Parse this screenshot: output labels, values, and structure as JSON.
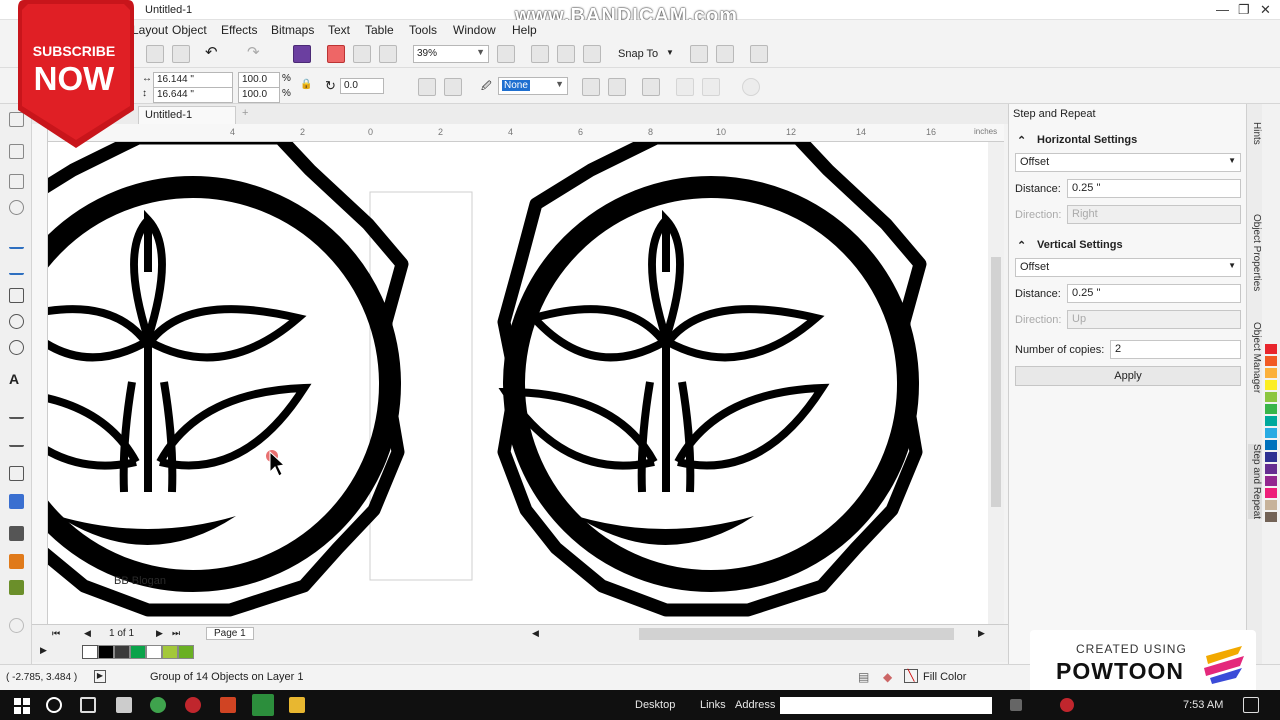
{
  "window": {
    "doc_title": "Untitled-1",
    "watermark": "www.BANDICAM.com",
    "min": "—",
    "max": "❐",
    "close": "✕"
  },
  "menu": [
    "Layout",
    "Object",
    "Effects",
    "Bitmaps",
    "Text",
    "Table",
    "Tools",
    "Window",
    "Help"
  ],
  "toolbar": {
    "zoom": "39%",
    "snap_to": "Snap To"
  },
  "property_bar": {
    "width": "16.144 \"",
    "height": "16.644 \"",
    "scale_x": "100.0",
    "scale_y": "100.0",
    "percent": "%",
    "angle": "0.0",
    "outline": "None"
  },
  "tabs": {
    "active": "Untitled-1",
    "add": "+"
  },
  "ruler": {
    "units": "inches",
    "ticks": [
      "4",
      "2",
      "0",
      "2",
      "4",
      "6",
      "8",
      "10",
      "12",
      "14",
      "16"
    ]
  },
  "canvas": {
    "faint_label": "BB Blogan"
  },
  "page_nav": {
    "counter": "1 of 1",
    "page_tab": "Page 1"
  },
  "palette": {
    "colors": [
      "#000000",
      "#ffffff",
      "#3a3a3a",
      "#000000",
      "#0aa34a",
      "#ffffff",
      "#a3c83a",
      "#6ab023",
      "#9acd32"
    ]
  },
  "status": {
    "coords": "( -2.785, 3.484 )",
    "selection": "Group of 14 Objects on Layer 1",
    "fill_label": "Fill Color"
  },
  "docker": {
    "title": "Step and Repeat",
    "horizontal": {
      "heading": "Horizontal Settings",
      "mode": "Offset",
      "distance_label": "Distance:",
      "distance": "0.25 \"",
      "direction_label": "Direction:",
      "direction": "Right"
    },
    "vertical": {
      "heading": "Vertical Settings",
      "mode": "Offset",
      "distance_label": "Distance:",
      "distance": "0.25 \"",
      "direction_label": "Direction:",
      "direction": "Up"
    },
    "copies_label": "Number of copies:",
    "copies": "2",
    "apply": "Apply"
  },
  "side_tabs": [
    "Hints",
    "Object Properties",
    "Object Manager",
    "Step and Repeat"
  ],
  "color_strip": [
    "#e8252c",
    "#f15a24",
    "#fbb03b",
    "#fcee21",
    "#8cc63f",
    "#39b54a",
    "#00a99d",
    "#29abe2",
    "#0071bc",
    "#2e3192",
    "#662d91",
    "#93278f",
    "#ed1e79",
    "#c7b299",
    "#736357"
  ],
  "overlay": {
    "subscribe_1": "SUBSCRIBE",
    "subscribe_2": "NOW",
    "powtoon_1": "CREATED USING",
    "powtoon_2": "POWTOON"
  },
  "taskbar": {
    "desktop": "Desktop",
    "links": "Links",
    "address": "Address",
    "time": "7:53 AM"
  }
}
